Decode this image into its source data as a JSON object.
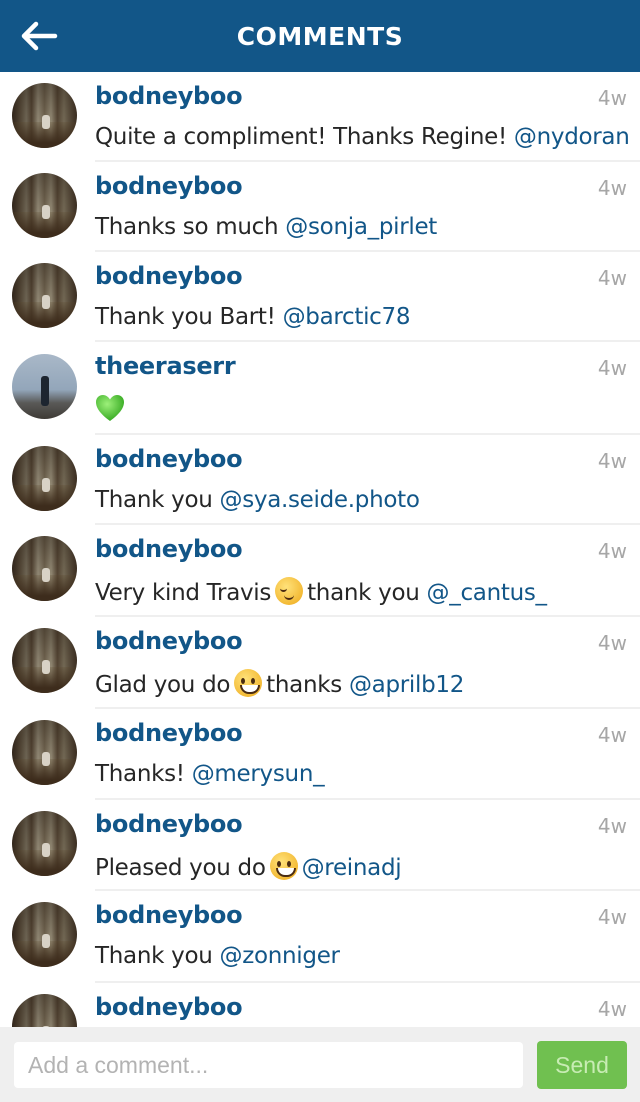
{
  "header": {
    "title": "COMMENTS",
    "back_icon": "arrow-left-icon",
    "background_color": "#125688"
  },
  "comments": [
    {
      "username": "bodneyboo",
      "time": "4w",
      "avatar": "forest",
      "parts": [
        {
          "t": "text",
          "v": "Quite a compliment! Thanks Regine! "
        },
        {
          "t": "mention",
          "v": "@nydoran"
        }
      ]
    },
    {
      "username": "bodneyboo",
      "time": "4w",
      "avatar": "forest",
      "parts": [
        {
          "t": "text",
          "v": "Thanks so much "
        },
        {
          "t": "mention",
          "v": "@sonja_pirlet"
        }
      ]
    },
    {
      "username": "bodneyboo",
      "time": "4w",
      "avatar": "forest",
      "parts": [
        {
          "t": "text",
          "v": "Thank you Bart! "
        },
        {
          "t": "mention",
          "v": "@barctic78"
        }
      ]
    },
    {
      "username": "theeraserr",
      "time": "4w",
      "avatar": "sky",
      "parts": [
        {
          "t": "emoji",
          "v": "green-heart"
        }
      ]
    },
    {
      "username": "bodneyboo",
      "time": "4w",
      "avatar": "forest",
      "parts": [
        {
          "t": "text",
          "v": "Thank you "
        },
        {
          "t": "mention",
          "v": "@sya.seide.photo"
        }
      ]
    },
    {
      "username": "bodneyboo",
      "time": "4w",
      "avatar": "forest",
      "parts": [
        {
          "t": "text",
          "v": "Very kind Travis"
        },
        {
          "t": "emoji",
          "v": "blush"
        },
        {
          "t": "text",
          "v": "thank you "
        },
        {
          "t": "mention",
          "v": "@_cantus_"
        }
      ]
    },
    {
      "username": "bodneyboo",
      "time": "4w",
      "avatar": "forest",
      "parts": [
        {
          "t": "text",
          "v": "Glad you do"
        },
        {
          "t": "emoji",
          "v": "smile"
        },
        {
          "t": "text",
          "v": "thanks "
        },
        {
          "t": "mention",
          "v": "@aprilb12"
        }
      ]
    },
    {
      "username": "bodneyboo",
      "time": "4w",
      "avatar": "forest",
      "parts": [
        {
          "t": "text",
          "v": "Thanks! "
        },
        {
          "t": "mention",
          "v": "@merysun_"
        }
      ]
    },
    {
      "username": "bodneyboo",
      "time": "4w",
      "avatar": "forest",
      "parts": [
        {
          "t": "text",
          "v": "Pleased you do"
        },
        {
          "t": "emoji",
          "v": "smile"
        },
        {
          "t": "mention",
          "v": "@reinadj"
        }
      ]
    },
    {
      "username": "bodneyboo",
      "time": "4w",
      "avatar": "forest",
      "parts": [
        {
          "t": "text",
          "v": "Thank you "
        },
        {
          "t": "mention",
          "v": "@zonniger"
        }
      ]
    },
    {
      "username": "bodneyboo",
      "time": "4w",
      "avatar": "forest",
      "parts": []
    }
  ],
  "footer": {
    "input_placeholder": "Add a comment...",
    "input_value": "",
    "send_label": "Send",
    "send_color": "#70c050"
  }
}
